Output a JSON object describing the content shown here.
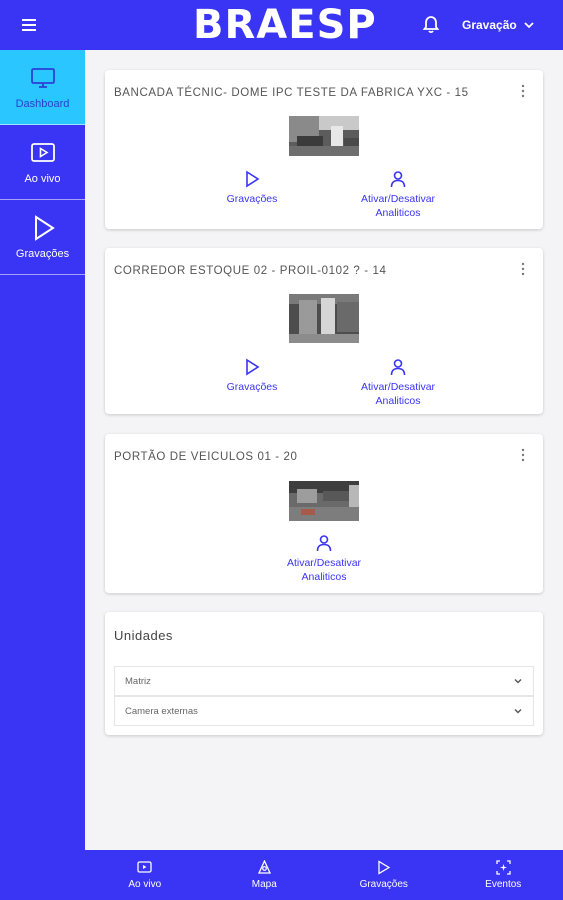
{
  "header": {
    "logo": "BRAESP",
    "user_menu_label": "Gravação"
  },
  "sidebar": {
    "items": [
      {
        "label": "Dashboard",
        "icon": "monitor-icon",
        "active": true
      },
      {
        "label": "Ao vivo",
        "icon": "live-icon",
        "active": false
      },
      {
        "label": "Gravações",
        "icon": "play-icon",
        "active": false
      }
    ]
  },
  "cameras": [
    {
      "title": "BANCADA TÉCNIC- DOME IPC TESTE DA FABRICA YXC - 15",
      "actions": {
        "recordings": "Gravações",
        "analytics": "Ativar/Desativar Analiticos"
      }
    },
    {
      "title": "CORREDOR ESTOQUE 02 - PROIL-0102 ? - 14",
      "actions": {
        "recordings": "Gravações",
        "analytics": "Ativar/Desativar Analiticos"
      }
    },
    {
      "title": "PORTÃO DE VEICULOS 01 - 20",
      "actions": {
        "analytics": "Ativar/Desativar Analiticos"
      }
    }
  ],
  "units": {
    "title": "Unidades",
    "items": [
      "Matriz",
      "Camera externas"
    ]
  },
  "bottom_nav": [
    {
      "label": "Ao vivo",
      "icon": "live-icon"
    },
    {
      "label": "Mapa",
      "icon": "map-pin-icon"
    },
    {
      "label": "Gravações",
      "icon": "play-icon"
    },
    {
      "label": "Eventos",
      "icon": "events-icon"
    }
  ],
  "colors": {
    "brand": "#3a34f5",
    "active_sidebar": "#29c6ff",
    "background": "#f4f4f6"
  }
}
